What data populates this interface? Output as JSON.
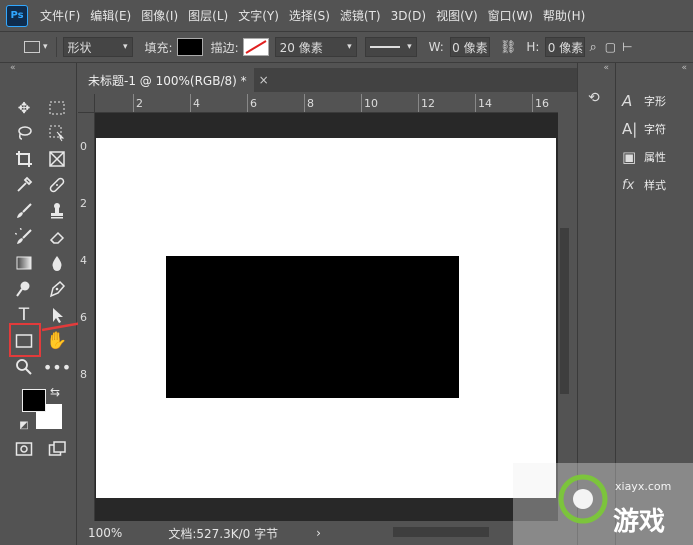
{
  "menubar": {
    "logo": "Ps",
    "items": [
      "文件(F)",
      "编辑(E)",
      "图像(I)",
      "图层(L)",
      "文字(Y)",
      "选择(S)",
      "滤镜(T)",
      "3D(D)",
      "视图(V)",
      "窗口(W)",
      "帮助(H)"
    ]
  },
  "options": {
    "mode": "形状",
    "fill_label": "填充:",
    "fill_color": "#000000",
    "stroke_label": "描边:",
    "stroke_width": "20 像素",
    "w_label": "W:",
    "w_value": "0 像素",
    "h_label": "H:",
    "h_value": "0 像素"
  },
  "document": {
    "tab_title": "未标题-1 @ 100%(RGB/8) *",
    "close": "×"
  },
  "ruler": {
    "h_labels": [
      "2",
      "4",
      "6",
      "8",
      "10",
      "12",
      "14",
      "16"
    ],
    "v_labels": [
      "0",
      "2",
      "4",
      "6",
      "8"
    ]
  },
  "status": {
    "zoom": "100%",
    "doc_info": "文档:527.3K/0 字节",
    "arrow": "›"
  },
  "panels": {
    "items": [
      {
        "icon": "A",
        "label": "字形"
      },
      {
        "icon": "A|",
        "label": "字符"
      },
      {
        "icon": "▣",
        "label": "属性"
      },
      {
        "icon": "fx",
        "label": "样式"
      }
    ]
  },
  "colors": {
    "foreground": "#000000",
    "background": "#ffffff",
    "highlight": "#e23b3b"
  },
  "watermark": {
    "site": "xiayx.com",
    "brand": "游戏"
  }
}
